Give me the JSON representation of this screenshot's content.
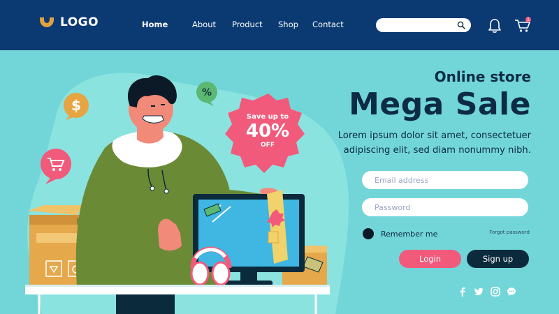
{
  "brand": {
    "logo_text": "LOGO",
    "header_color": "#0b3a72",
    "accent_color": "#f25a7b",
    "background_color": "#72d6d8"
  },
  "nav": {
    "items": [
      {
        "label": "Home",
        "active": true
      },
      {
        "label": "About"
      },
      {
        "label": "Product"
      },
      {
        "label": "Shop"
      },
      {
        "label": "Contact"
      }
    ]
  },
  "search": {
    "value": "",
    "icon": "search-icon"
  },
  "header_icons": {
    "bell": "bell-icon",
    "cart": "cart-icon",
    "cart_badge": "1"
  },
  "hero": {
    "subtitle": "Online store",
    "headline": "Mega Sale",
    "description": "Lorem ipsum dolor sit amet, consectetuer adipiscing elit, sed diam nonummy nibh."
  },
  "promo_badge": {
    "line1": "Save up to",
    "percent": "40%",
    "line2": "OFF"
  },
  "form": {
    "email_placeholder": "Email address",
    "password_placeholder": "Password",
    "remember_label": "Remember me",
    "forgot_label": "Forgot password",
    "login_label": "Login",
    "signup_label": "Sign up"
  },
  "social_icons": [
    "facebook-icon",
    "twitter-icon",
    "instagram-icon",
    "chat-icon"
  ]
}
